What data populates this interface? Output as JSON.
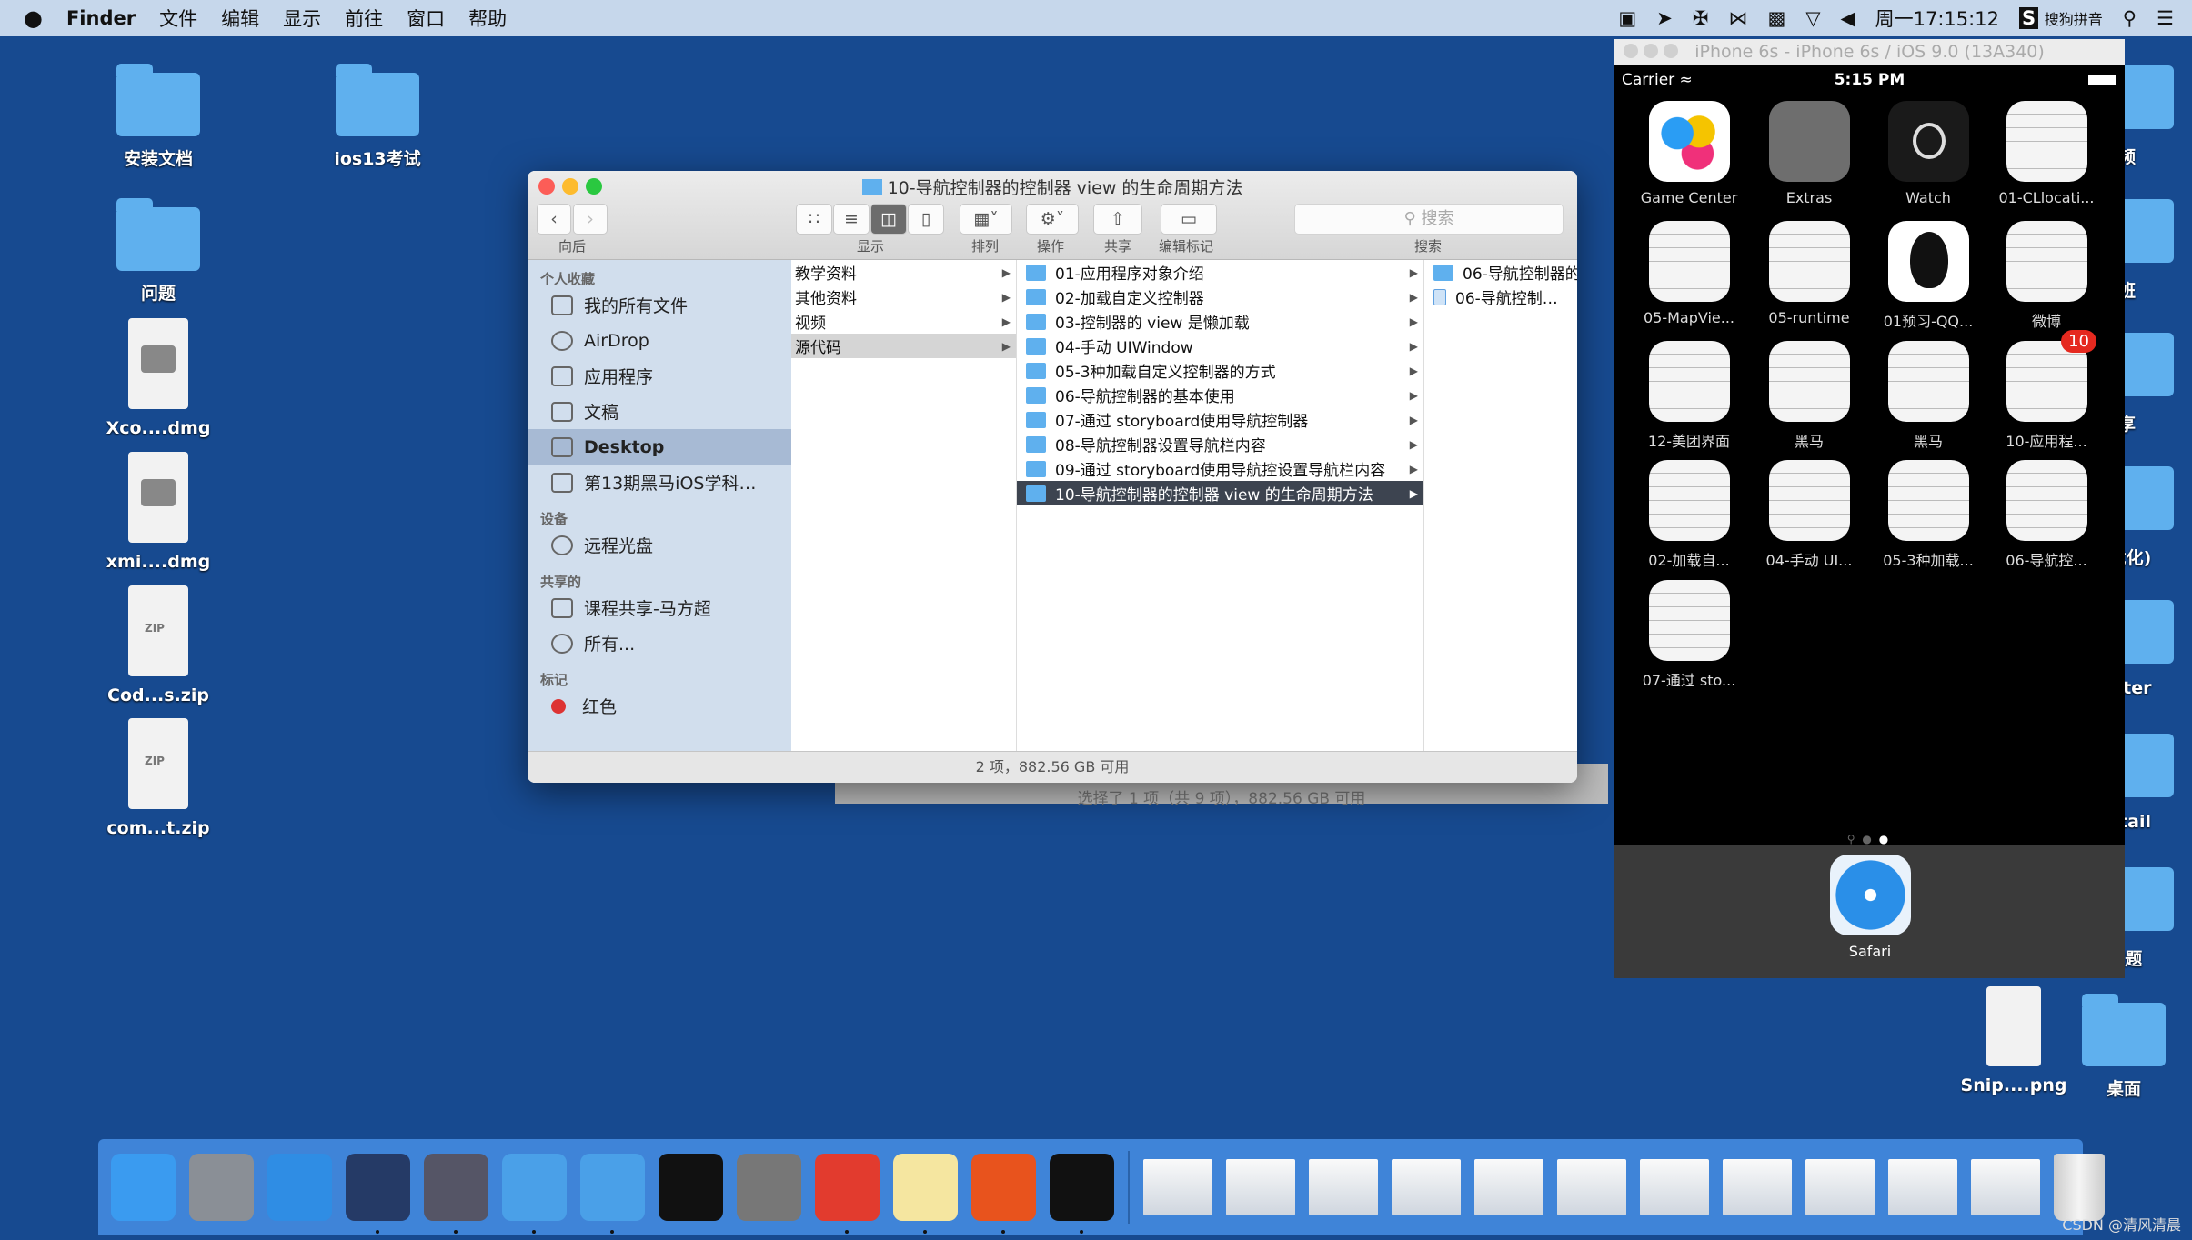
{
  "menubar": {
    "apple": "",
    "app": "Finder",
    "items": [
      "文件",
      "编辑",
      "显示",
      "前往",
      "窗口",
      "帮助"
    ],
    "clock": "周一17:15:12",
    "ime": "搜狗拼音",
    "icons": [
      "screen-record-icon",
      "location-icon",
      "bluetooth-icon",
      "network-icon",
      "lock-icon",
      "wifi-icon",
      "volume-icon",
      "search-icon",
      "list-icon"
    ]
  },
  "desktop": {
    "left_icons": [
      {
        "label": "安装文档",
        "kind": "folder"
      },
      {
        "label": "ios13考试",
        "kind": "folder"
      },
      {
        "label": "问题",
        "kind": "folder"
      },
      {
        "label": "Xco....dmg",
        "kind": "dmg"
      },
      {
        "label": "xmi....dmg",
        "kind": "dmg"
      },
      {
        "label": "Cod...s.zip",
        "kind": "zip"
      },
      {
        "label": "com...t.zip",
        "kind": "zip"
      }
    ],
    "right_icons": [
      "视频",
      "业班",
      "分享",
      "(优化)",
      "aster",
      ".etail",
      ".试题"
    ],
    "bottom_icons": [
      {
        "label": "Snip....png",
        "kind": "png"
      },
      {
        "label": "桌面",
        "kind": "folder"
      }
    ]
  },
  "finder": {
    "title": "10-导航控制器的控制器 view 的生命周期方法",
    "toolbar": {
      "back_label": "向后",
      "view_label": "显示",
      "arrange_label": "排列",
      "action_label": "操作",
      "share_label": "共享",
      "tag_label": "编辑标记",
      "search_placeholder": "搜索",
      "search_label": "搜索"
    },
    "sidebar": [
      {
        "header": "个人收藏",
        "items": [
          {
            "label": "我的所有文件",
            "icon": "all-files-icon"
          },
          {
            "label": "AirDrop",
            "icon": "airdrop-icon"
          },
          {
            "label": "应用程序",
            "icon": "applications-icon"
          },
          {
            "label": "文稿",
            "icon": "documents-icon"
          },
          {
            "label": "Desktop",
            "icon": "desktop-icon",
            "selected": true
          },
          {
            "label": "第13期黑马iOS学科…",
            "icon": "folder-icon"
          }
        ]
      },
      {
        "header": "设备",
        "items": [
          {
            "label": "远程光盘",
            "icon": "disc-icon"
          }
        ]
      },
      {
        "header": "共享的",
        "items": [
          {
            "label": "课程共享-马方超",
            "icon": "computer-icon"
          },
          {
            "label": "所有...",
            "icon": "network-icon"
          }
        ]
      },
      {
        "header": "标记",
        "items": [
          {
            "label": "红色",
            "icon": "red-tag-icon"
          }
        ]
      }
    ],
    "column1": [
      {
        "name": "教学资料"
      },
      {
        "name": "其他资料"
      },
      {
        "name": "视频"
      },
      {
        "name": "源代码",
        "selected": true
      }
    ],
    "column2": [
      "01-应用程序对象介绍",
      "02-加载自定义控制器",
      "03-控制器的 view 是懒加载",
      "04-手动 UIWindow",
      "05-3种加载自定义控制器的方式",
      "06-导航控制器的基本使用",
      "07-通过 storyboard使用导航控制器",
      "08-导航控制器设置导航栏内容",
      "09-通过 storyboard使用导航控设置导航栏内容",
      "10-导航控制器的控制器 view 的生命周期方法"
    ],
    "column2_selected": 9,
    "column3": [
      {
        "name": "06-导航控制器的",
        "kind": "folder"
      },
      {
        "name": "06-导航控制…",
        "kind": "file"
      }
    ],
    "status": "2 项，882.56 GB 可用",
    "behind_status": "选择了 1 项（共 9 项），882.56 GB 可用"
  },
  "simulator": {
    "title": "iPhone 6s - iPhone 6s / iOS 9.0 (13A340)",
    "carrier": "Carrier",
    "time": "5:15 PM",
    "battery_level": 1.0,
    "apps": [
      {
        "label": "Game Center",
        "icon": "game-center-icon"
      },
      {
        "label": "Extras",
        "icon": "extras-folder-icon"
      },
      {
        "label": "Watch",
        "icon": "watch-icon"
      },
      {
        "label": "01-CLlocati...",
        "icon": "placeholder-app-icon"
      },
      {
        "label": "05-MapVie...",
        "icon": "placeholder-app-icon"
      },
      {
        "label": "05-runtime",
        "icon": "placeholder-app-icon"
      },
      {
        "label": "01预习-QQ...",
        "icon": "qq-icon"
      },
      {
        "label": "微博",
        "icon": "placeholder-app-icon"
      },
      {
        "label": "12-美团界面",
        "icon": "placeholder-app-icon"
      },
      {
        "label": "黑马",
        "icon": "placeholder-app-icon"
      },
      {
        "label": "黑马",
        "icon": "placeholder-app-icon"
      },
      {
        "label": "10-应用程...",
        "icon": "placeholder-app-icon",
        "badge": "10"
      },
      {
        "label": "02-加载自...",
        "icon": "placeholder-app-icon"
      },
      {
        "label": "04-手动 UI...",
        "icon": "placeholder-app-icon"
      },
      {
        "label": "05-3种加载...",
        "icon": "placeholder-app-icon"
      },
      {
        "label": "06-导航控...",
        "icon": "placeholder-app-icon"
      },
      {
        "label": "07-通过 sto...",
        "icon": "placeholder-app-icon"
      }
    ],
    "page_count": 2,
    "current_page": 2,
    "dock": [
      {
        "label": "Safari",
        "icon": "safari-icon"
      }
    ]
  },
  "dock": {
    "apps": [
      {
        "icon": "finder-icon",
        "color": "#3a9bf0",
        "running": false
      },
      {
        "icon": "launchpad-icon",
        "color": "#8a8f96",
        "running": false
      },
      {
        "icon": "safari-icon",
        "color": "#2f8de4",
        "running": false
      },
      {
        "icon": "mouse-icon",
        "color": "#253a66",
        "running": true
      },
      {
        "icon": "photo-slideshow-icon",
        "color": "#556",
        "running": true
      },
      {
        "icon": "xcode-icon",
        "color": "#4aa0e8",
        "running": true
      },
      {
        "icon": "instruments-icon",
        "color": "#4aa0e8",
        "running": true
      },
      {
        "icon": "terminal-icon",
        "color": "#111",
        "running": false
      },
      {
        "icon": "system-preferences-icon",
        "color": "#777",
        "running": false
      },
      {
        "icon": "xmind-icon",
        "color": "#e23b2e",
        "running": true
      },
      {
        "icon": "notes-icon",
        "color": "#f5e6a0",
        "running": true
      },
      {
        "icon": "pages-icon",
        "color": "#e8531d",
        "running": true
      },
      {
        "icon": "console-icon",
        "color": "#111",
        "running": true
      }
    ],
    "docs": [
      "document-thumbnail-icon",
      "document-thumbnail-icon",
      "document-thumbnail-icon",
      "document-thumbnail-icon",
      "document-thumbnail-icon",
      "document-thumbnail-icon",
      "document-thumbnail-icon",
      "document-thumbnail-icon",
      "document-thumbnail-icon",
      "document-thumbnail-icon",
      "document-thumbnail-icon"
    ],
    "trash": "trash-icon"
  },
  "watermark": "CSDN @清风清晨"
}
